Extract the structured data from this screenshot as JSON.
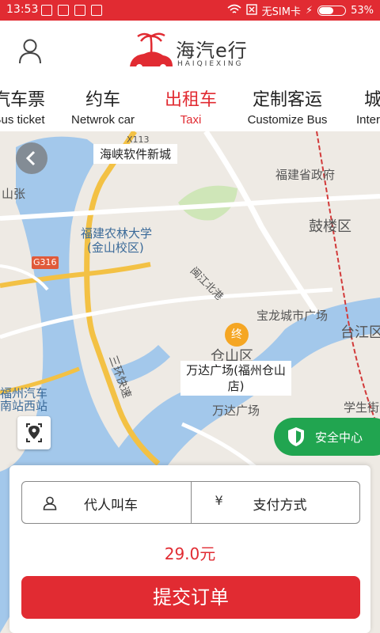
{
  "status_bar": {
    "time": "13:53",
    "carrier": "无SIM卡",
    "battery_pct": "53%",
    "battery_level": 0.53
  },
  "header": {
    "logo_title": "海汽e行",
    "logo_sub": "HAIQIEXING"
  },
  "tabs": [
    {
      "cn": "汽车票",
      "en": "Bus ticket"
    },
    {
      "cn": "约车",
      "en": "Netwrok car"
    },
    {
      "cn": "出租车",
      "en": "Taxi",
      "active": true
    },
    {
      "cn": "定制客运",
      "en": "Customize Bus"
    },
    {
      "cn": "城",
      "en": "Inter"
    }
  ],
  "map": {
    "labels": {
      "software_city": "海峡软件新城",
      "shan_zhang": "山张",
      "g316": "G316",
      "fafu": "福建农林大学",
      "fafu_campus": "(金山校区)",
      "gov": "福建省政府",
      "gulou": "鼓楼区",
      "minjiang_north": "闽江北港",
      "baolong": "宝龙城市广场",
      "taijiang": "台江区",
      "cangshan": "仓山区",
      "third_ring": "三环快速",
      "wanda": "万达广场",
      "bus_station_1": "福州汽车",
      "bus_station_2": "南站西站",
      "student": "学生街",
      "x113": "X113"
    },
    "destination_marker": "终",
    "destination_callout": "万达广场(福州仓山店)",
    "safety_center": "安全中心"
  },
  "panel": {
    "proxy_call": "代人叫车",
    "payment": "支付方式",
    "price": "29.0元",
    "submit": "提交订单"
  },
  "colors": {
    "brand_red": "#e12b32",
    "safety_green": "#21a550",
    "marker_orange": "#f5a623",
    "water": "#a3c8eb"
  }
}
